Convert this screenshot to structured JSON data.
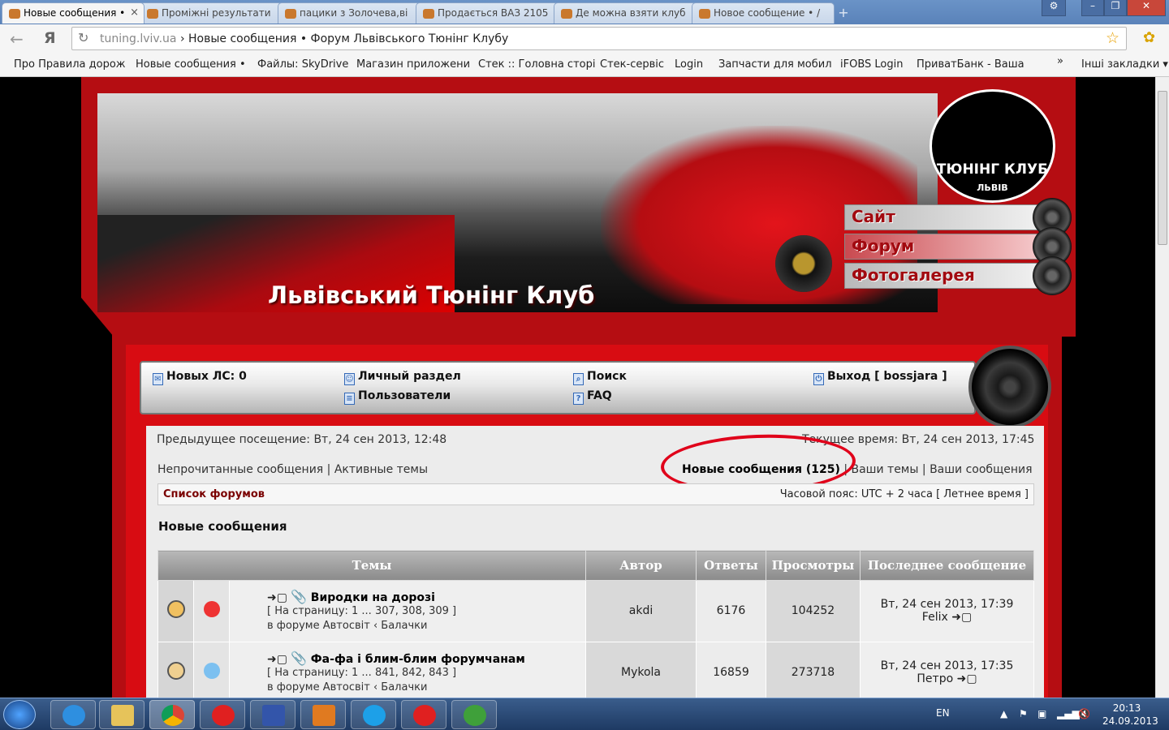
{
  "browser": {
    "tabs": [
      {
        "title": "Новые сообщения • ",
        "active": true
      },
      {
        "title": "Проміжні результати"
      },
      {
        "title": "пацики з Золочева,ві"
      },
      {
        "title": "Продається ВАЗ 2105"
      },
      {
        "title": "Де можна взяти клуб"
      },
      {
        "title": "Новое сообщение • /"
      }
    ],
    "address": {
      "host": "tuning.lviv.ua",
      "title": " › Новые сообщения • Форум Львівського Тюнінг Клубу"
    },
    "bookmarks": [
      "Про Правила дорож",
      "Новые сообщения •",
      "Файлы: SkyDrive",
      "Магазин приложени",
      "Стек :: Головна сторі",
      "Стек-сервіс",
      "Login",
      "Запчасти для мобил",
      "iFOBS Login",
      "ПриватБанк - Ваша",
      "»",
      "Інші закладки ▾"
    ]
  },
  "header": {
    "site_title": "Львівський Тюнінг Клуб",
    "logo_text": "ТЮНІНГ КЛУБ",
    "logo_sub": "ЛЬВІВ",
    "nav": [
      "Сайт",
      "Форум",
      "Фотогалерея"
    ]
  },
  "menu": {
    "pm": "Новых ЛС: 0",
    "ucp": "Личный раздел",
    "members": "Пользователи",
    "search": "Поиск",
    "faq": "FAQ",
    "logout": "Выход [ bossjara ]"
  },
  "info": {
    "last_visit": "Предыдущее посещение: Вт, 24 сен 2013, 12:48",
    "current_time": "Текущее время: Вт, 24 сен 2013, 17:45",
    "unread": "Непрочитанные сообщения",
    "active": "Активные темы",
    "new_posts": "Новые сообщения (125)",
    "your_topics": "Ваши темы",
    "your_posts": "Ваши сообщения",
    "forum_index": "Список форумов",
    "timezone": "Часовой пояс: UTC + 2 часа [ Летнее время ]",
    "page_title": "Новые сообщения"
  },
  "table": {
    "headers": [
      "Темы",
      "Автор",
      "Ответы",
      "Просмотры",
      "Последнее сообщение"
    ],
    "rows": [
      {
        "title": "Виродки на дорозі",
        "pages": "[ На страницу: 1 ... 307, 308, 309 ]",
        "forum": "в форуме Автосвіт ‹ Балачки",
        "author": "akdi",
        "replies": "6176",
        "views": "104252",
        "last_date": "Вт, 24 сен 2013, 17:39",
        "last_user": "Felix"
      },
      {
        "title": "Фа-фа і блим-блим форумчанам",
        "pages": "[ На страницу: 1 ... 841, 842, 843 ]",
        "forum": "в форуме Автосвіт ‹ Балачки",
        "author": "Mykola",
        "replies": "16859",
        "views": "273718",
        "last_date": "Вт, 24 сен 2013, 17:35",
        "last_user": "Петро"
      }
    ]
  },
  "taskbar": {
    "lang": "EN",
    "time": "20:13",
    "date": "24.09.2013"
  },
  "colors": {
    "brand_red": "#b50d12",
    "highlight_ring": "#e0001a",
    "link_dark_red": "#7a0000"
  }
}
